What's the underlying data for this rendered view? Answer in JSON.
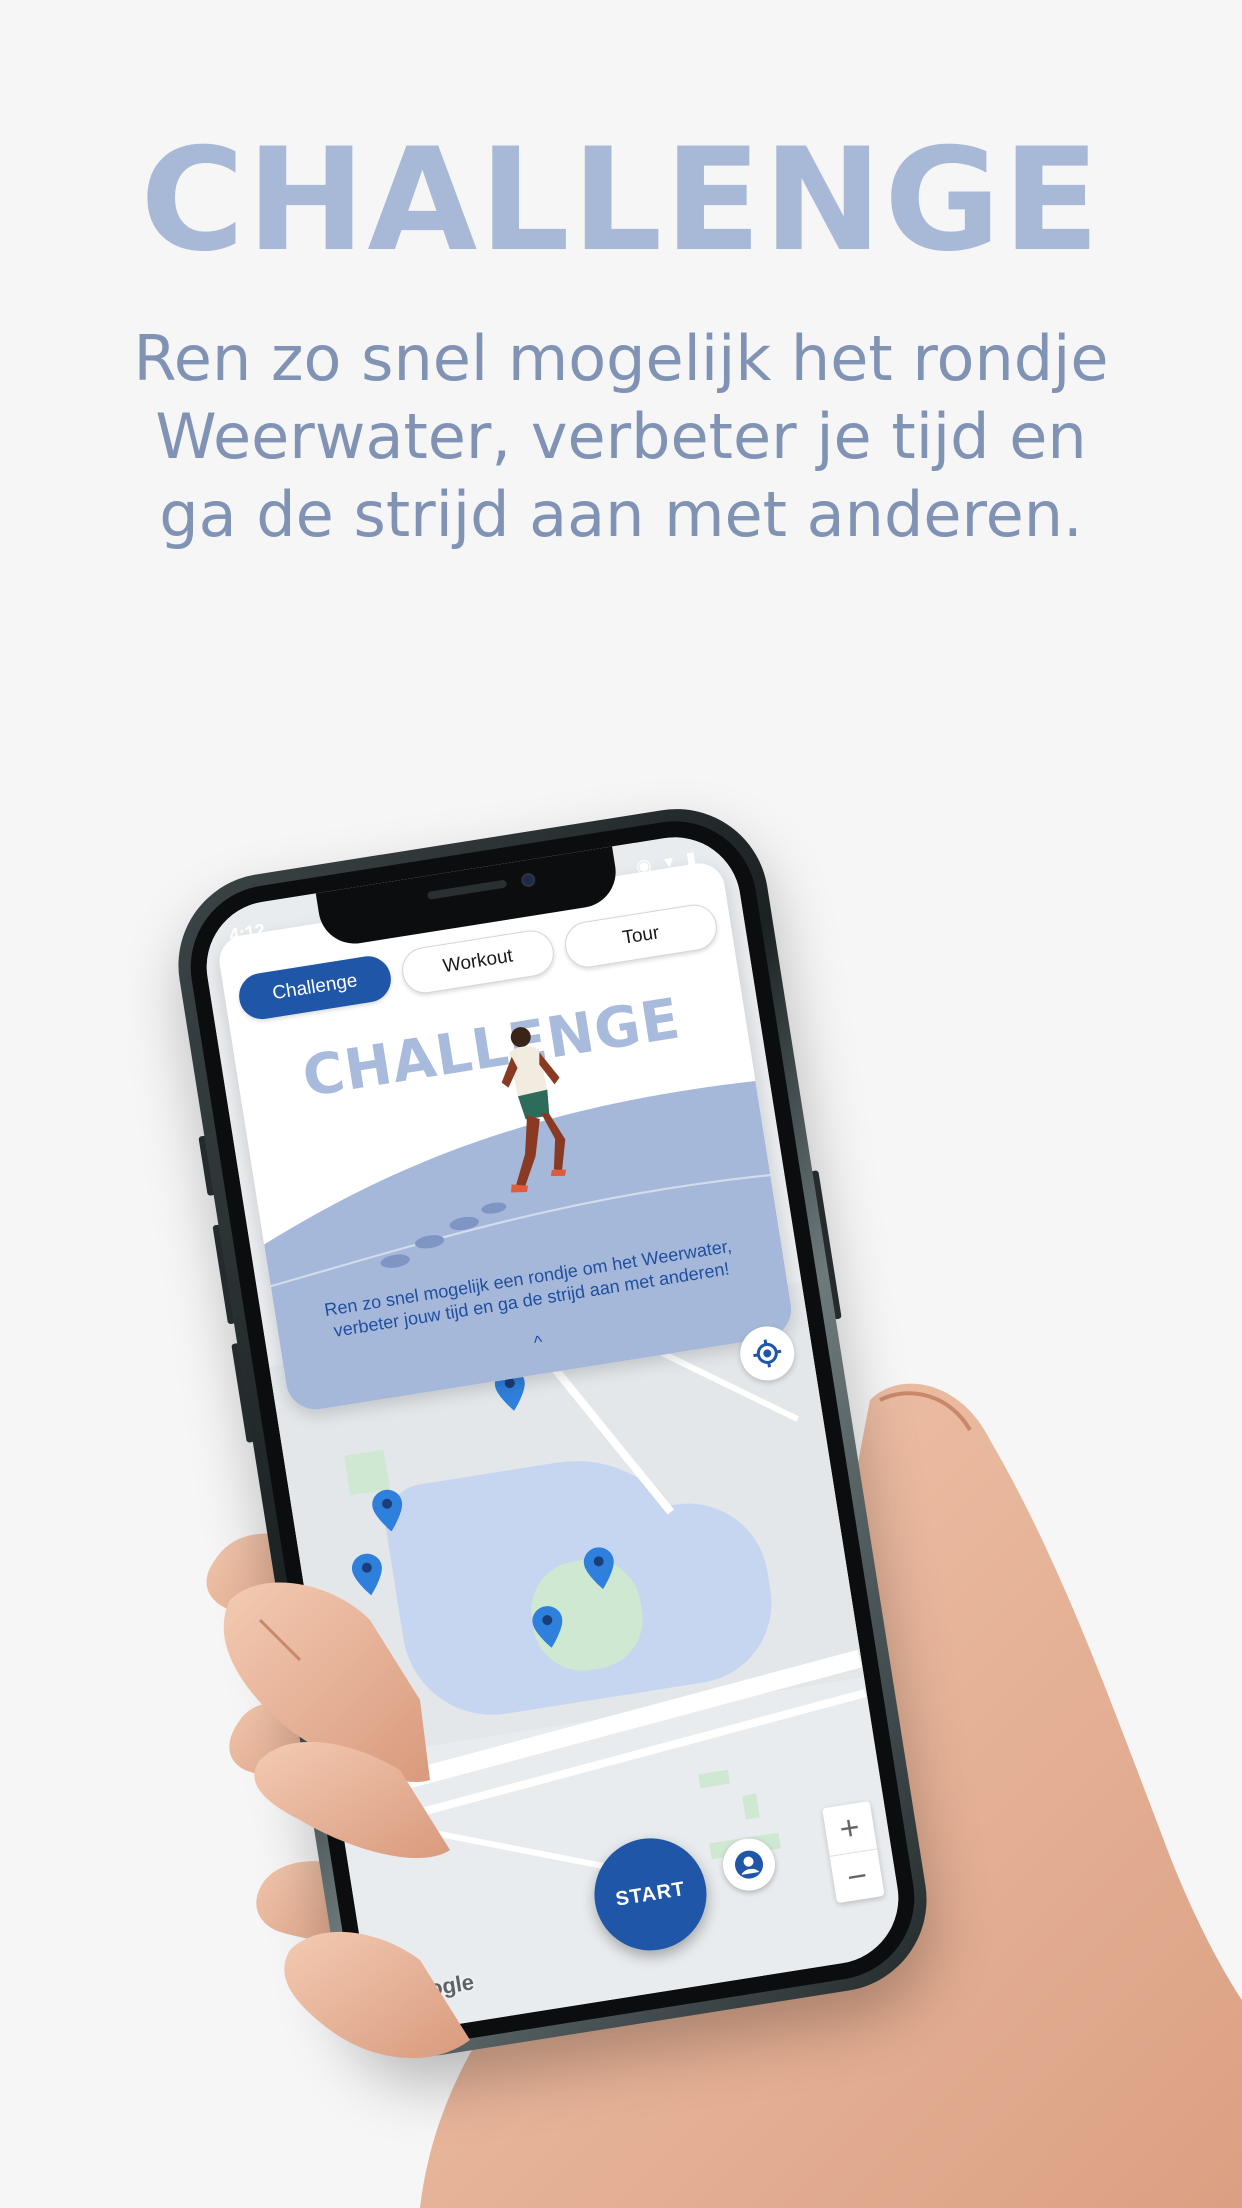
{
  "headline": "CHALLENGE",
  "subtitle": "Ren zo snel mogelijk het rondje Weerwater, verbeter je tijd en ga de strijd aan met anderen.",
  "phone": {
    "status_time": "4:12",
    "status_icons": "◉ ▾ ▮",
    "tabs": [
      {
        "label": "Challenge",
        "active": true
      },
      {
        "label": "Workout",
        "active": false
      },
      {
        "label": "Tour",
        "active": false
      }
    ],
    "card": {
      "title": "CHALLENGE",
      "description_line1": "Ren zo snel mogelijk een rondje om het Weerwater,",
      "description_line2": "verbeter jouw tijd en ga de strijd aan met anderen!",
      "chevron": "^"
    },
    "start_label": "START",
    "zoom_in": "+",
    "zoom_out": "−",
    "map_attribution": "Google"
  },
  "colors": {
    "brand_blue": "#1f56a8",
    "headline": "#a8b9d8",
    "subtitle": "#8193b5",
    "lake": "#c6d6f0",
    "pin": "#2f80dc"
  }
}
